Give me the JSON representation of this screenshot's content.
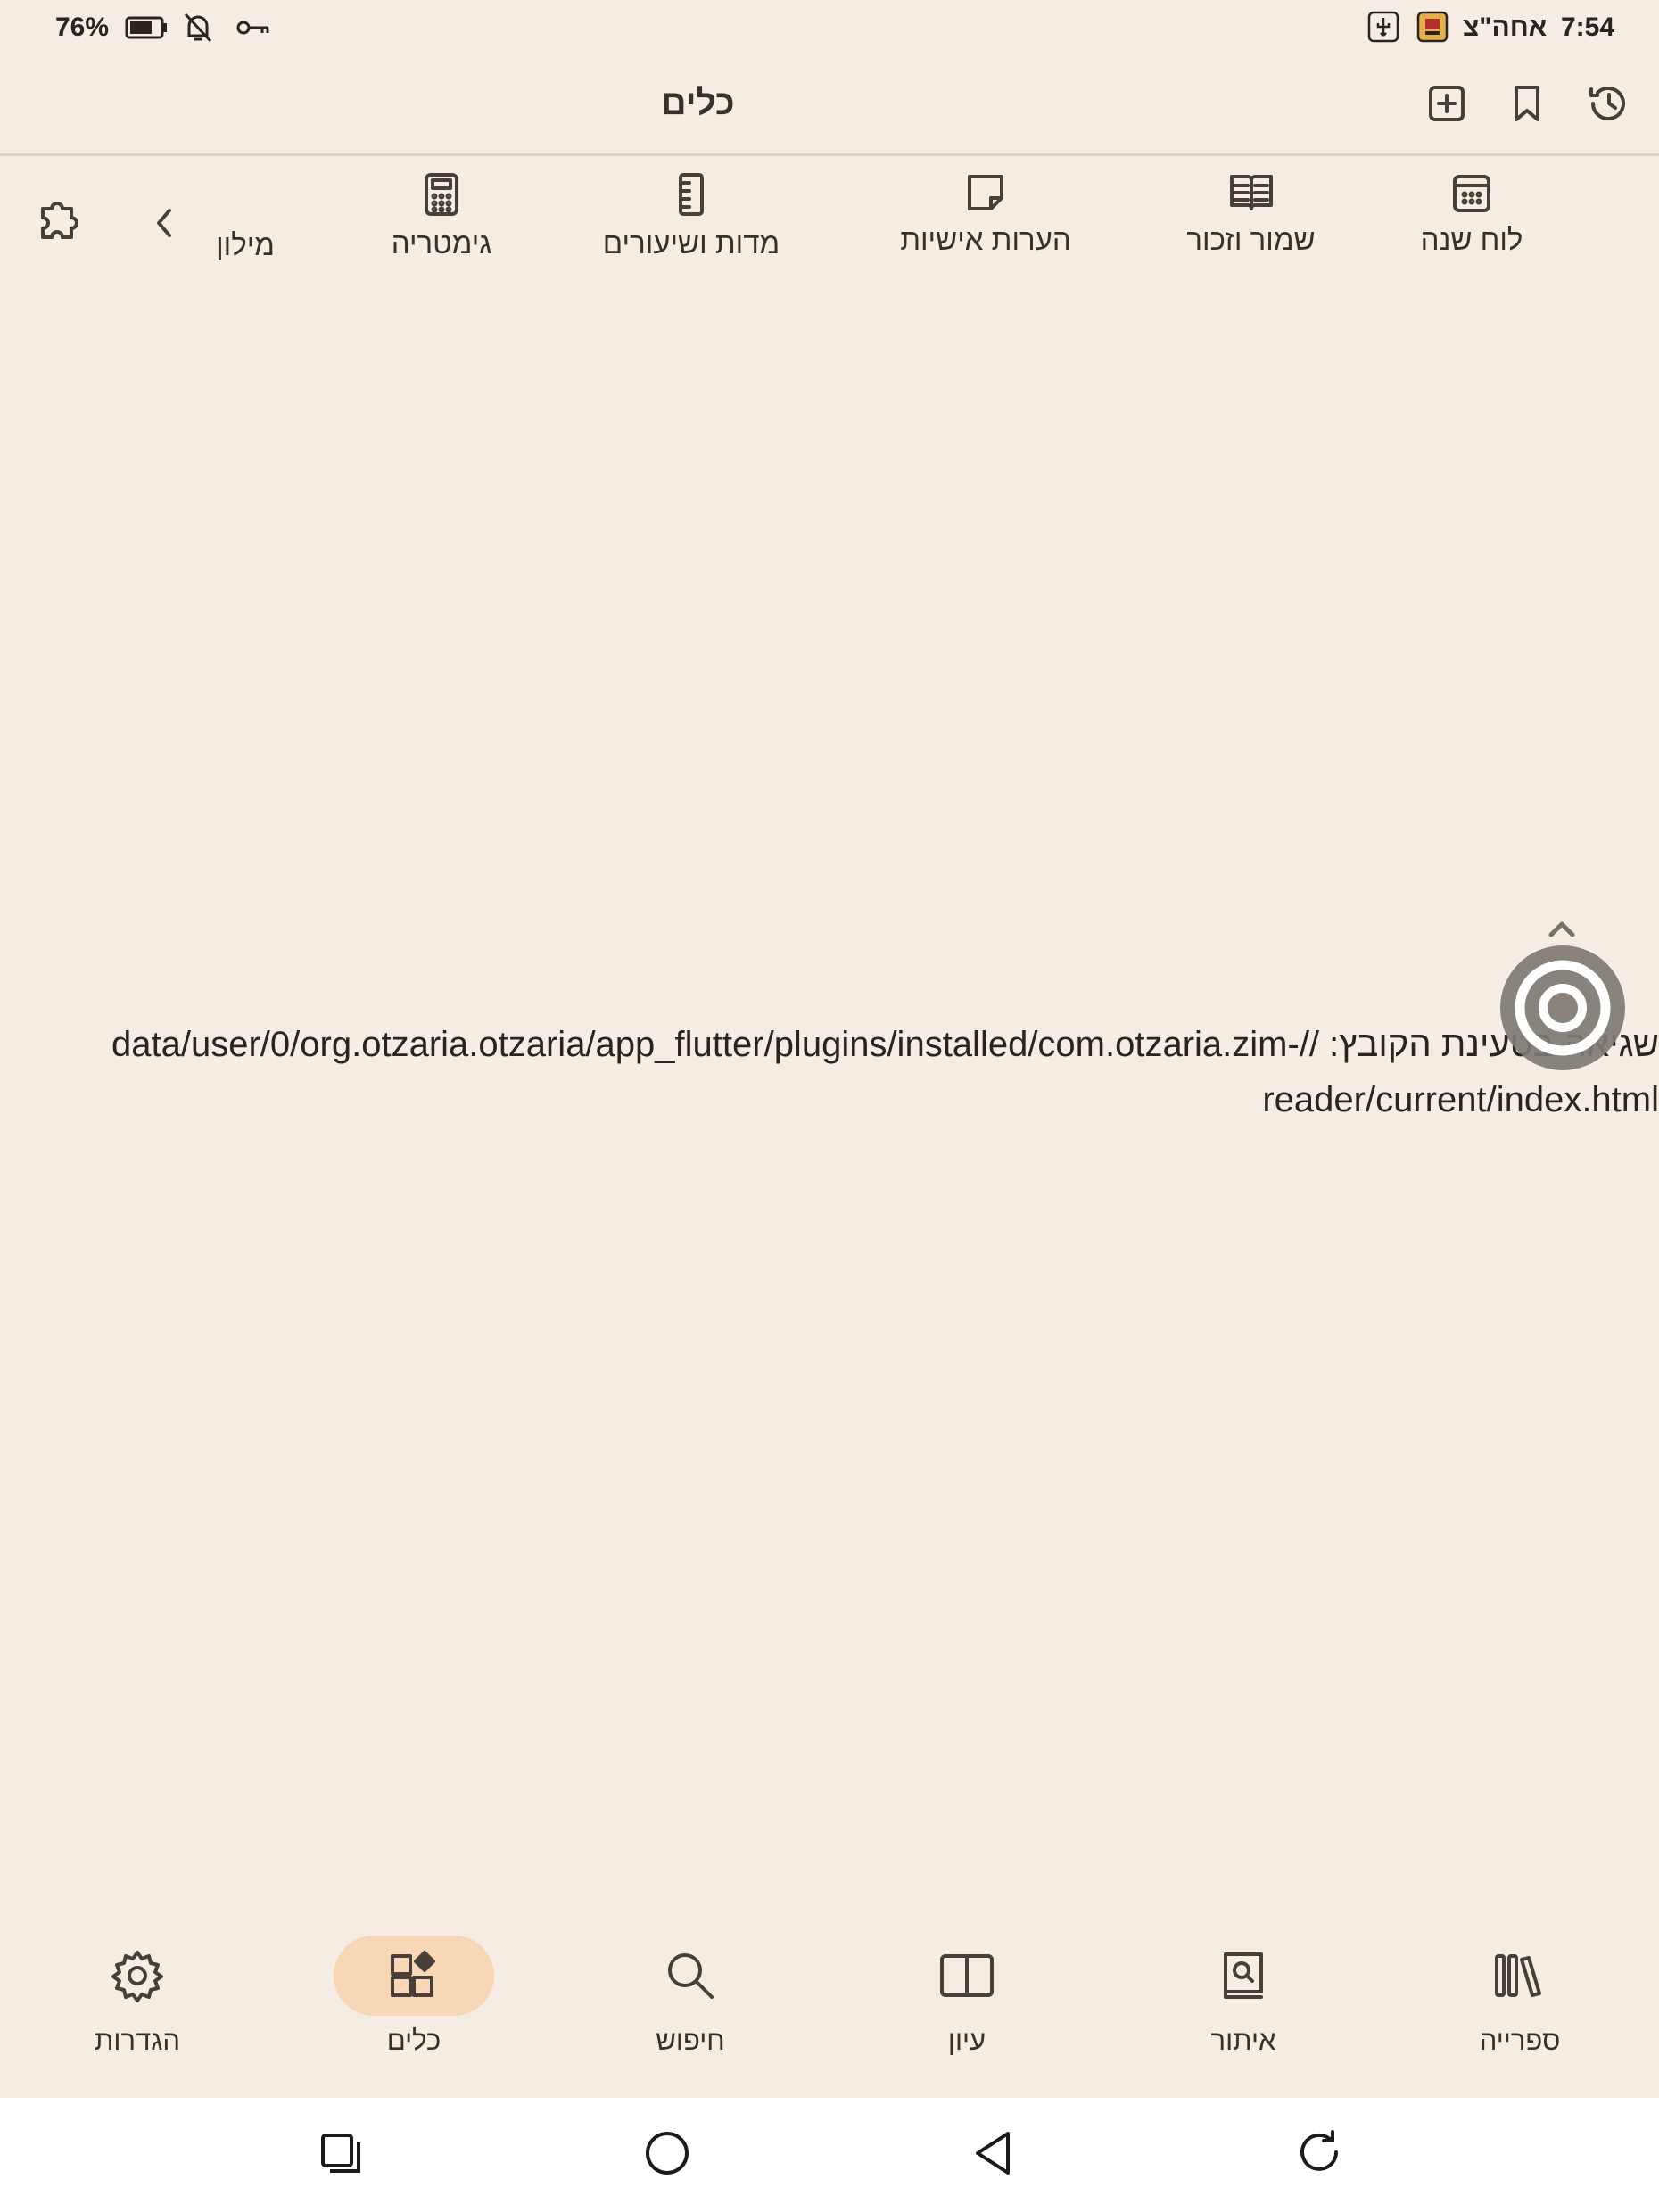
{
  "status_bar": {
    "time": "7:54",
    "date_hebrew": "אחה\"צ",
    "battery": "76%",
    "icons": [
      "usb-icon",
      "app-notification-icon",
      "battery-icon",
      "bell-off-icon",
      "key-icon"
    ]
  },
  "app_bar": {
    "title": "כלים",
    "actions": [
      "add-tab-icon",
      "bookmark-icon",
      "history-icon"
    ]
  },
  "tools": {
    "items": [
      {
        "label": "לוח שנה",
        "icon": "calendar-icon"
      },
      {
        "label": "שמור וזכור",
        "icon": "book-open-icon"
      },
      {
        "label": "הערות אישיות",
        "icon": "sticky-note-icon"
      },
      {
        "label": "מדות ושיעורים",
        "icon": "ruler-icon"
      },
      {
        "label": "גימטריה",
        "icon": "calculator-icon"
      },
      {
        "label": "מילון",
        "icon": ""
      }
    ],
    "scroll_icon": "chevron-left-icon",
    "plugins_icon": "puzzle-icon"
  },
  "error": {
    "message": "שגיאה בטעינת הקובץ: //data/user/0/org.otzaria.otzaria/app_flutter/plugins/installed/com.otzaria.zim-reader/current/index.html"
  },
  "bottom_nav": {
    "items": [
      {
        "label": "ספרייה",
        "icon": "library-icon",
        "active": false
      },
      {
        "label": "איתור",
        "icon": "find-book-icon",
        "active": false
      },
      {
        "label": "עיון",
        "icon": "open-book-icon",
        "active": false
      },
      {
        "label": "חיפוש",
        "icon": "search-icon",
        "active": false
      },
      {
        "label": "כלים",
        "icon": "tools-icon",
        "active": true
      },
      {
        "label": "הגדרות",
        "icon": "gear-icon",
        "active": false
      }
    ]
  },
  "colors": {
    "background": "#f5ece3",
    "active_pill": "#f7d7b6",
    "text": "#3a302a"
  }
}
